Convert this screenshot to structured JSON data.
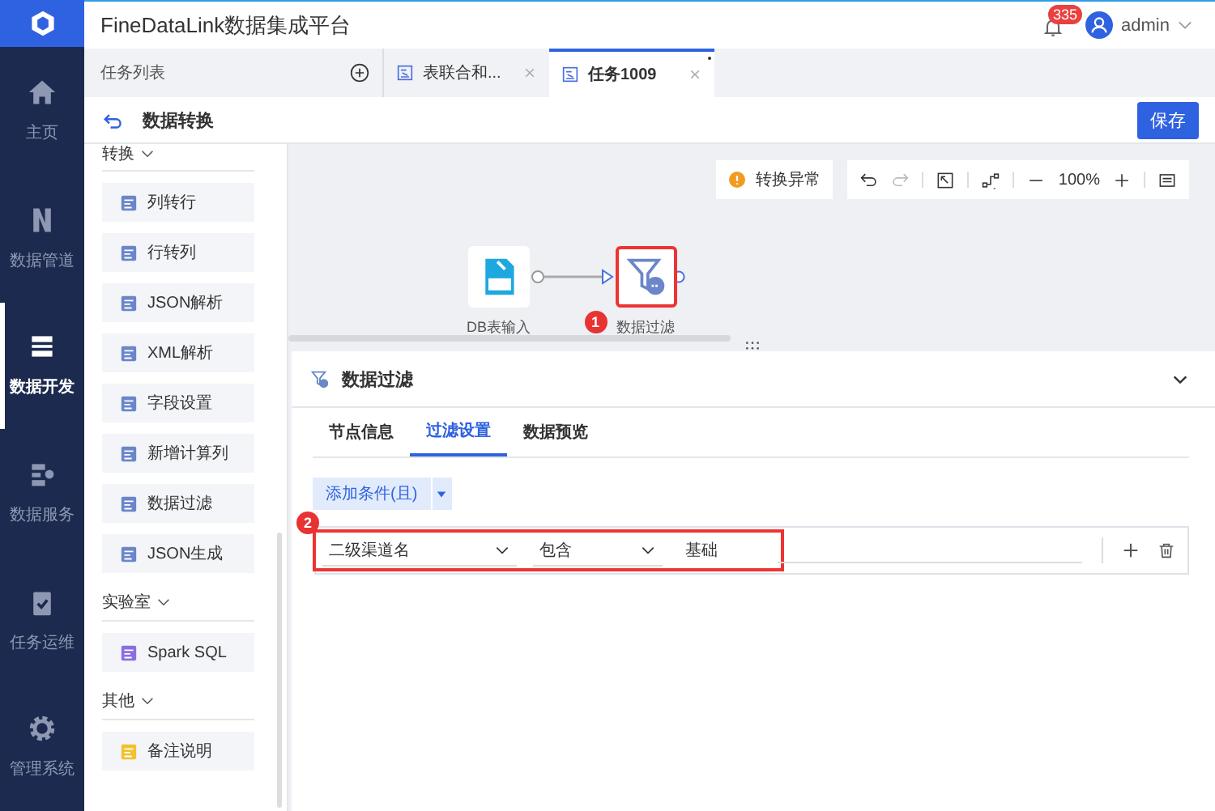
{
  "app": {
    "title": "FineDataLink数据集成平台",
    "notifications": "335",
    "user": "admin"
  },
  "nav": [
    {
      "label": "主页",
      "kind": "home",
      "selected": false
    },
    {
      "label": "数据管道",
      "kind": "pipe",
      "selected": false
    },
    {
      "label": "数据开发",
      "kind": "dev",
      "selected": true
    },
    {
      "label": "数据服务",
      "kind": "service",
      "selected": false
    },
    {
      "label": "任务运维",
      "kind": "ops",
      "selected": false
    },
    {
      "label": "管理系统",
      "kind": "gear",
      "selected": false
    }
  ],
  "task_list": {
    "title": "任务列表"
  },
  "tabs": [
    {
      "label": "表联合和...",
      "selected": false,
      "modified": false
    },
    {
      "label": "任务1009",
      "selected": true,
      "modified": true
    }
  ],
  "page": {
    "title": "数据转换",
    "save": "保存"
  },
  "palette": [
    {
      "group": "转换",
      "expanded": true,
      "items": [
        "列转行",
        "行转列",
        "JSON解析",
        "XML解析",
        "字段设置",
        "新增计算列",
        "数据过滤",
        "JSON生成"
      ]
    },
    {
      "group": "实验室",
      "expanded": true,
      "items": [
        "Spark SQL"
      ]
    },
    {
      "group": "其他",
      "expanded": true,
      "items": [
        "备注说明"
      ]
    }
  ],
  "canvas": {
    "status": "转换异常",
    "zoom": "100%",
    "nodes": [
      {
        "label": "DB表输入",
        "kind": "db",
        "highlighted": false
      },
      {
        "label": "数据过滤",
        "kind": "filter",
        "highlighted": true,
        "marker": "1"
      }
    ]
  },
  "panel": {
    "title": "数据过滤",
    "tabs": [
      {
        "label": "节点信息",
        "selected": false
      },
      {
        "label": "过滤设置",
        "selected": true
      },
      {
        "label": "数据预览",
        "selected": false
      }
    ],
    "add_button": "添加条件(且)",
    "marker": "2",
    "condition": {
      "field": "二级渠道名",
      "operator": "包含",
      "value": "基础",
      "highlighted": true
    }
  }
}
